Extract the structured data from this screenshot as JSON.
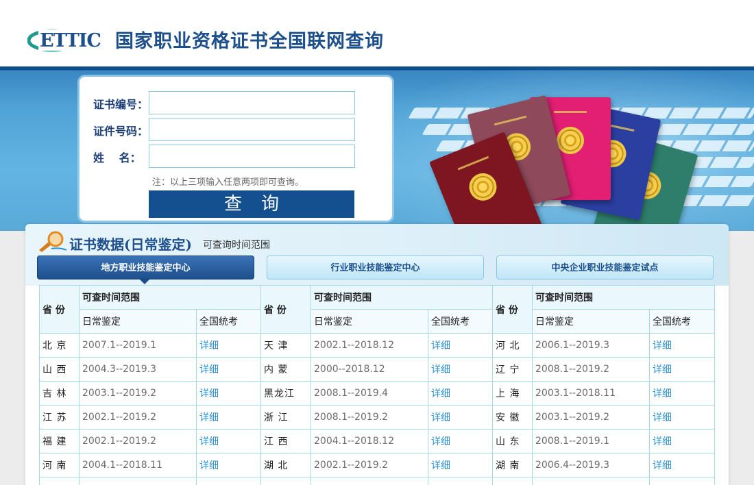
{
  "header": {
    "logo_text": "ETTIC",
    "title": "国家职业资格证书全国联网查询"
  },
  "search": {
    "cert_no_label": "证书编号：",
    "id_no_label": "证件号码：",
    "name_label": "姓　  名：",
    "cert_no_value": "",
    "id_no_value": "",
    "name_value": "",
    "note": "注：以上三项输入任意两项即可查询。",
    "submit_label": "查询"
  },
  "data_section": {
    "title": "证书数据(日常鉴定)",
    "subtitle": "可查询时间范围",
    "tabs": [
      {
        "label": "地方职业技能鉴定中心",
        "active": true
      },
      {
        "label": "行业职业技能鉴定中心",
        "active": false
      },
      {
        "label": "中央企业职业技能鉴定试点",
        "active": false
      }
    ],
    "columns": {
      "province": "省 份",
      "range": "可查时间范围",
      "daily": "日常鉴定",
      "national": "全国统考"
    },
    "rows": [
      [
        {
          "province": "北 京",
          "daily": "2007.1--2019.1",
          "national": "详细"
        },
        {
          "province": "天 津",
          "daily": "2002.1--2018.12",
          "national": "详细"
        },
        {
          "province": "河 北",
          "daily": "2006.1--2019.3",
          "national": "详细"
        }
      ],
      [
        {
          "province": "山 西",
          "daily": "2004.3--2019.3",
          "national": "详细"
        },
        {
          "province": "内 蒙",
          "daily": "2000--2018.12",
          "national": "详细"
        },
        {
          "province": "辽 宁",
          "daily": "2008.1--2019.2",
          "national": "详细"
        }
      ],
      [
        {
          "province": "吉 林",
          "daily": "2003.1--2019.2",
          "national": "详细"
        },
        {
          "province": "黑龙江",
          "daily": "2008.1--2019.4",
          "national": "详细"
        },
        {
          "province": "上 海",
          "daily": "2003.1--2018.11",
          "national": "详细"
        }
      ],
      [
        {
          "province": "江 苏",
          "daily": "2002.1--2019.2",
          "national": "详细"
        },
        {
          "province": "浙 江",
          "daily": "2008.1--2019.2",
          "national": "详细"
        },
        {
          "province": "安 徽",
          "daily": "2003.1--2019.2",
          "national": "详细"
        }
      ],
      [
        {
          "province": "福 建",
          "daily": "2002.1--2019.2",
          "national": "详细"
        },
        {
          "province": "江 西",
          "daily": "2004.1--2018.12",
          "national": "详细"
        },
        {
          "province": "山 东",
          "daily": "2008.1--2019.1",
          "national": "详细"
        }
      ],
      [
        {
          "province": "河 南",
          "daily": "2004.1--2018.11",
          "national": "详细"
        },
        {
          "province": "湖 北",
          "daily": "2002.1--2019.2",
          "national": "详细"
        },
        {
          "province": "湖 南",
          "daily": "2006.4--2019.3",
          "national": "详细"
        }
      ],
      [
        {
          "province": "",
          "daily": "",
          "national": ""
        },
        {
          "province": "",
          "daily": "",
          "national": ""
        },
        {
          "province": "",
          "daily": "",
          "national": ""
        }
      ]
    ]
  },
  "colors": {
    "brand_blue": "#1d4f8c",
    "link_blue": "#2b8fd1",
    "logo_teal": "#1f9a8c",
    "button_blue": "#14508f"
  },
  "icons": [
    "ettic-logo",
    "magnifier-icon",
    "certificate-image"
  ]
}
